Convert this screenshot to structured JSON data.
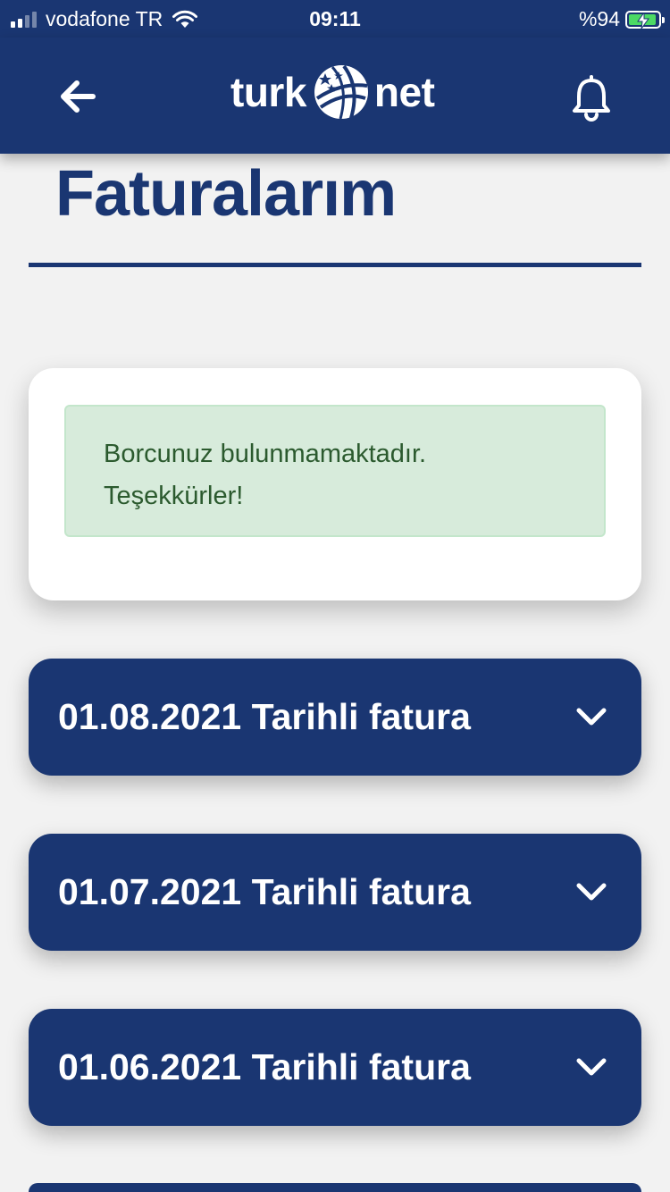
{
  "status_bar": {
    "carrier": "vodafone TR",
    "time": "09:11",
    "battery_label": "%94",
    "battery_percent": 94
  },
  "header": {
    "logo_left": "turk",
    "logo_right": "net",
    "back_icon": "arrow-left-icon",
    "notification_icon": "bell-icon"
  },
  "page": {
    "title": "Faturalarım"
  },
  "alert": {
    "line1": "Borcunuz bulunmamaktadır.",
    "line2": "Teşekkürler!"
  },
  "invoices": [
    {
      "label": "01.08.2021 Tarihli fatura"
    },
    {
      "label": "01.07.2021 Tarihli fatura"
    },
    {
      "label": "01.06.2021 Tarihli fatura"
    },
    {
      "label": ""
    }
  ],
  "colors": {
    "brand": "#1a3672",
    "background": "#f2f2f2",
    "alert_bg": "#d7ebdb",
    "alert_text": "#2b5a2e",
    "battery": "#4cd964"
  }
}
